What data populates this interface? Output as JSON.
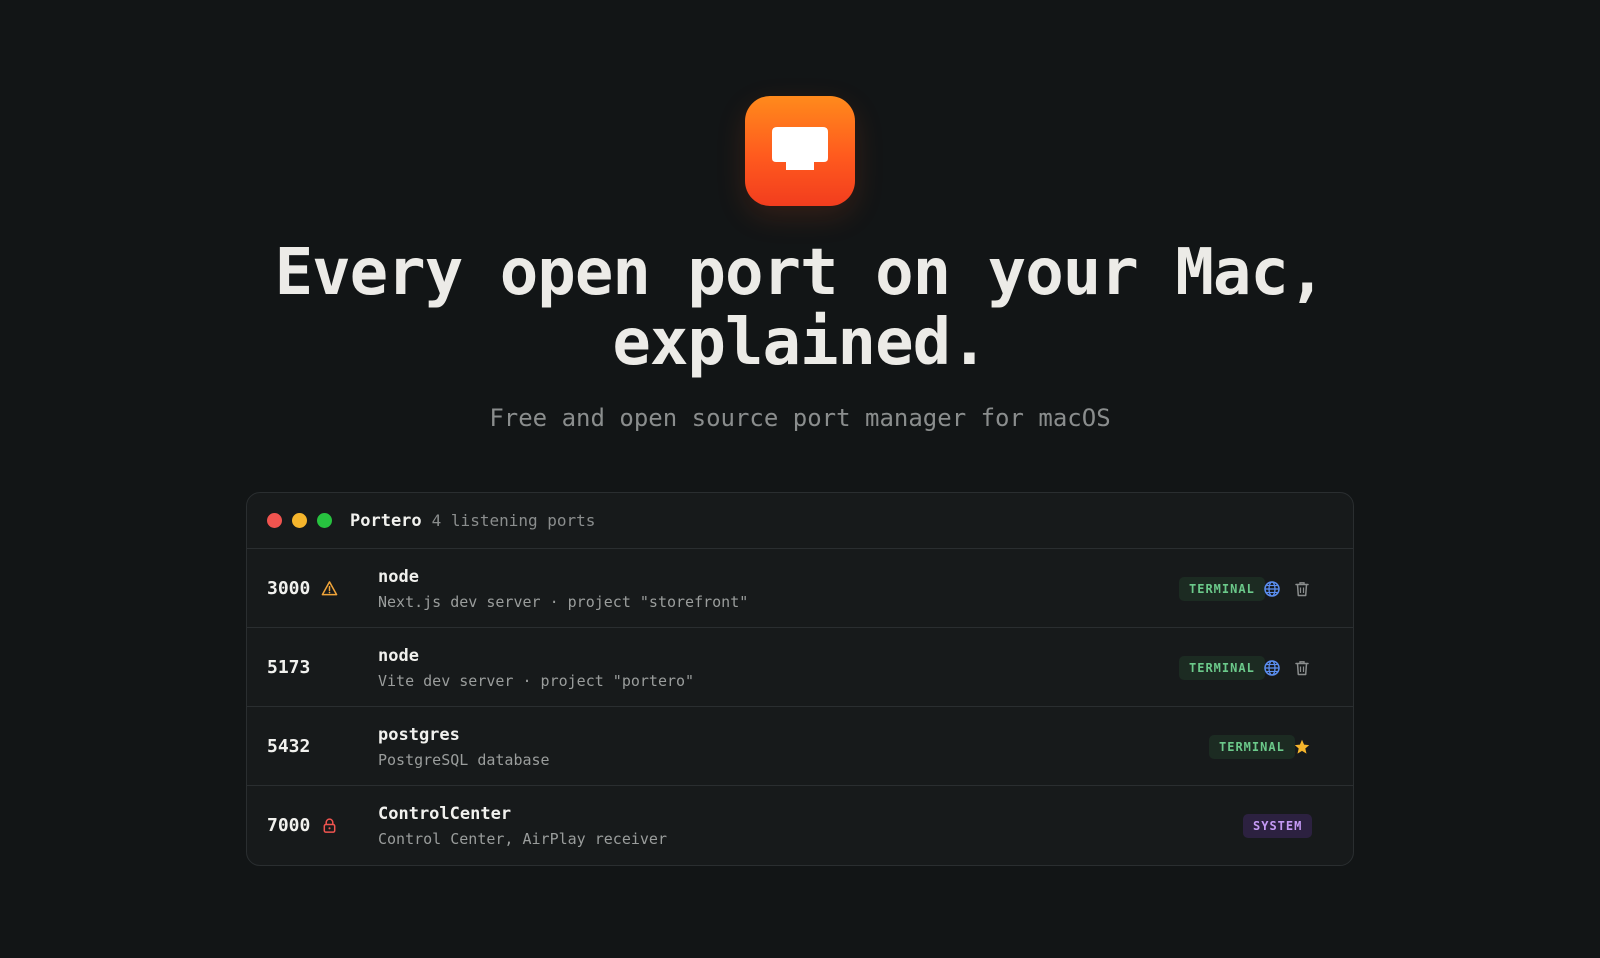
{
  "hero": {
    "headline_line1": "Every open port on your Mac,",
    "headline_line2": "explained.",
    "subtitle": "Free and open source port manager for macOS"
  },
  "window": {
    "app_name": "Portero",
    "port_count_label": "4 listening ports"
  },
  "rows": [
    {
      "port": "3000",
      "status_icon": "warning-icon",
      "process": "node",
      "description": "Next.js dev server · project \"storefront\"",
      "badge": "TERMINAL",
      "actions": [
        "globe-icon",
        "trash-icon"
      ]
    },
    {
      "port": "5173",
      "status_icon": "",
      "process": "node",
      "description": "Vite dev server · project \"portero\"",
      "badge": "TERMINAL",
      "actions": [
        "globe-icon",
        "trash-icon"
      ]
    },
    {
      "port": "5432",
      "status_icon": "",
      "process": "postgres",
      "description": "PostgreSQL database",
      "badge": "TERMINAL",
      "actions": [
        "star-icon"
      ]
    },
    {
      "port": "7000",
      "status_icon": "lock-icon",
      "process": "ControlCenter",
      "description": "Control Center, AirPlay receiver",
      "badge": "SYSTEM",
      "actions": []
    }
  ],
  "colors": {
    "background": "#121516",
    "accent_orange": "#ff6a1e",
    "terminal_badge_text": "#6bc98a",
    "system_badge_text": "#c59af5",
    "warning": "#f0a43a",
    "lock": "#f0544f",
    "globe": "#5b8ff0",
    "star": "#f5b52c"
  }
}
